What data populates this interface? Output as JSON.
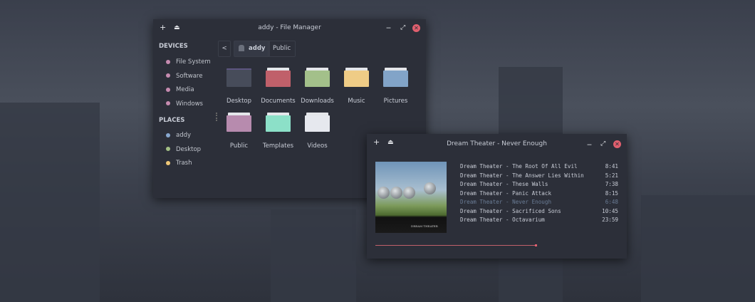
{
  "file_manager": {
    "title": "addy - File Manager",
    "icons": [
      "plus-icon",
      "eject-icon",
      "minimize-icon",
      "maximize-icon",
      "close-icon"
    ],
    "sidebar": {
      "devices_heading": "DEVICES",
      "devices": [
        {
          "label": "File System",
          "color": "#c68bb0"
        },
        {
          "label": "Software",
          "color": "#c68bb0"
        },
        {
          "label": "Media",
          "color": "#c68bb0"
        },
        {
          "label": "Windows",
          "color": "#c68bb0"
        }
      ],
      "places_heading": "PLACES",
      "places": [
        {
          "label": "addy",
          "color": "#88a8d0"
        },
        {
          "label": "Desktop",
          "color": "#a3c085"
        },
        {
          "label": "Trash",
          "color": "#efc877"
        }
      ]
    },
    "breadcrumb": {
      "back": "<",
      "items": [
        "addy",
        "Public"
      ]
    },
    "folders": [
      {
        "label": "Desktop",
        "color": "#474c5a"
      },
      {
        "label": "Documents",
        "color": "#c0606a"
      },
      {
        "label": "Downloads",
        "color": "#a3c08a"
      },
      {
        "label": "Music",
        "color": "#efcc86"
      },
      {
        "label": "Pictures",
        "color": "#82a4c8"
      },
      {
        "label": "Public",
        "color": "#b78bae"
      },
      {
        "label": "Templates",
        "color": "#8ce0c8"
      },
      {
        "label": "Videos",
        "color": "#e6e8ee"
      }
    ]
  },
  "player": {
    "title": "Dream Theater - Never Enough",
    "album_art_text": "DREAM THEATER",
    "tracks": [
      {
        "title": "Dream Theater - The Root Of All Evil",
        "duration": "8:41"
      },
      {
        "title": "Dream Theater - The Answer Lies Within",
        "duration": "5:21"
      },
      {
        "title": "Dream Theater - These Walls",
        "duration": "7:38"
      },
      {
        "title": "Dream Theater - Panic Attack",
        "duration": "8:15"
      },
      {
        "title": "Dream Theater - Never Enough",
        "duration": "6:48",
        "current": true
      },
      {
        "title": "Dream Theater - Sacrificed Sons",
        "duration": "10:45"
      },
      {
        "title": "Dream Theater - Octavarium",
        "duration": "23:59"
      }
    ],
    "progress": 0.66,
    "accent": "#c0606a"
  }
}
